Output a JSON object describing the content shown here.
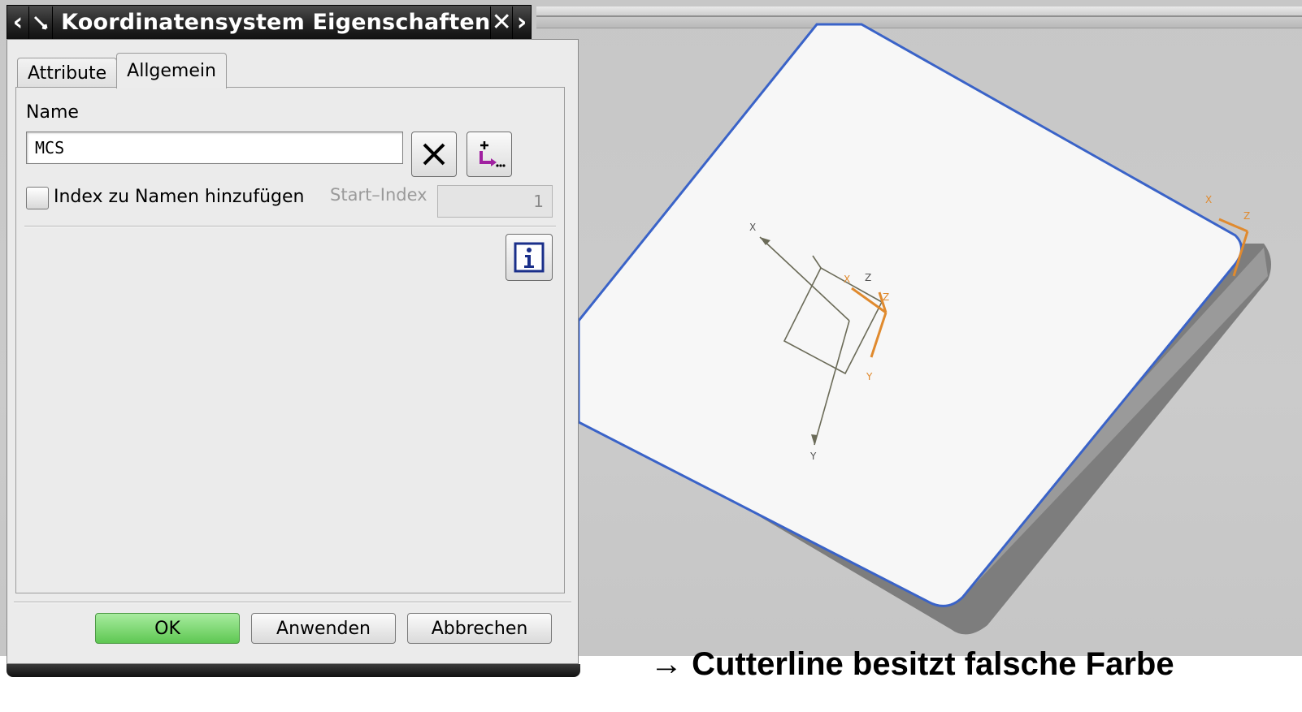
{
  "dialog": {
    "title": "Koordinatensystem Eigenschaften",
    "nav_prev_icon": "chevron-left-icon",
    "pin_icon": "pin-icon",
    "close_icon": "close-icon",
    "nav_next_icon": "chevron-right-icon",
    "tabs": [
      {
        "label": "Attribute",
        "active": false
      },
      {
        "label": "Allgemein",
        "active": true
      }
    ],
    "name_label": "Name",
    "name_value": "MCS",
    "clear_icon": "clear-x-icon",
    "add_icon": "add-expression-icon",
    "index_checkbox_label": "Index zu Namen hinzufügen",
    "index_checked": false,
    "start_index_label": "Start–Index",
    "start_index_value": "1",
    "info_icon": "info-icon",
    "buttons": {
      "ok": "OK",
      "apply": "Anwenden",
      "cancel": "Abbrechen"
    },
    "ok_color": "#6fd063"
  },
  "viewport": {
    "axis_labels_mcs": {
      "x": "X",
      "y": "Y",
      "z": "Z"
    },
    "axis_labels_wcs": {
      "x": "X",
      "y": "Y",
      "z": "Z"
    },
    "part_edge_color": "#3a63c8",
    "wcs_color": "#e08a2e"
  },
  "caption": "→ Cutterline besitzt falsche Farbe"
}
